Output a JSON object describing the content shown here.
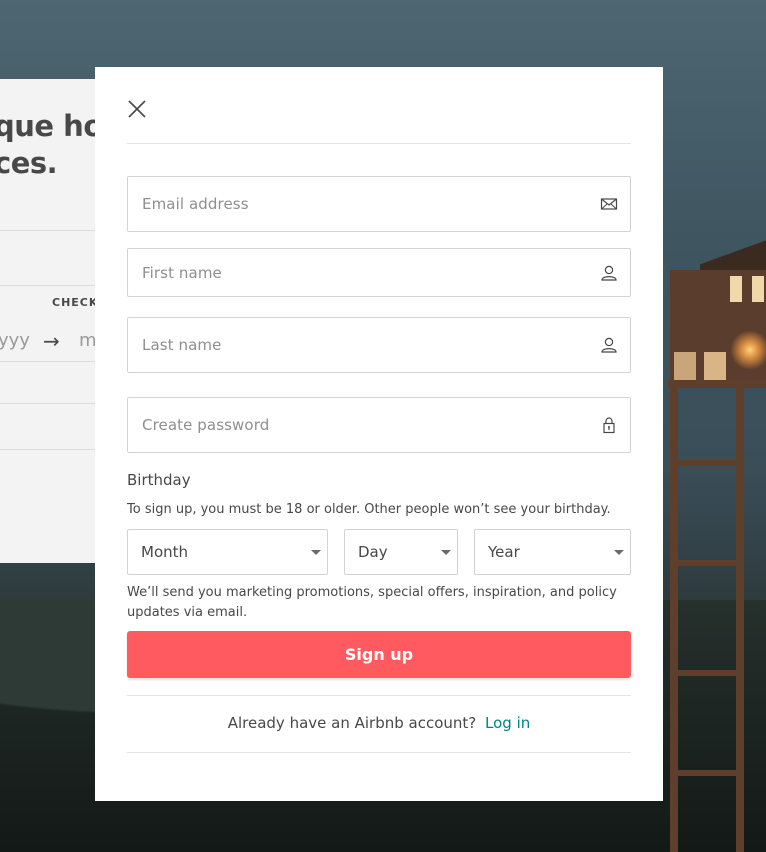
{
  "background": {
    "hero_title": "que hor\nces.",
    "check_label": "CHECK",
    "date_from": "yyy",
    "arrow": "→",
    "date_to": "m"
  },
  "modal": {
    "close_icon": "close-icon",
    "fields": {
      "email": {
        "placeholder": "Email address",
        "icon": "envelope-icon"
      },
      "first_name": {
        "placeholder": "First name",
        "icon": "user-icon"
      },
      "last_name": {
        "placeholder": "Last name",
        "icon": "user-icon"
      },
      "password": {
        "placeholder": "Create password",
        "icon": "lock-icon"
      }
    },
    "birthday": {
      "label": "Birthday",
      "note": "To sign up, you must be 18 or older. Other people won’t see your birthday.",
      "month": "Month",
      "day": "Day",
      "year": "Year"
    },
    "promo_text": "We’ll send you marketing promotions, special offers, inspiration, and policy updates via email.",
    "signup_label": "Sign up",
    "login_prompt": "Already have an Airbnb account?",
    "login_link": "Log in",
    "colors": {
      "primary": "#ff5a5f",
      "link": "#008489",
      "text": "#484848"
    }
  }
}
